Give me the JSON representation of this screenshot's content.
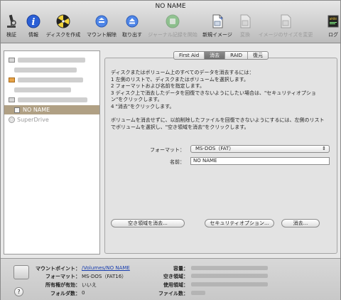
{
  "window": {
    "title": "NO NAME"
  },
  "toolbar": {
    "items": [
      {
        "label": "検証",
        "icon": "microscope-icon"
      },
      {
        "label": "情報",
        "icon": "info-icon"
      },
      {
        "label": "ディスクを作成",
        "icon": "burn-disc-icon"
      },
      {
        "label": "マウント解除",
        "icon": "unmount-icon"
      },
      {
        "label": "取り出す",
        "icon": "eject-icon"
      },
      {
        "label": "ジャーナル記録を開始",
        "icon": "journal-icon",
        "disabled": true
      },
      {
        "label": "新規イメージ",
        "icon": "new-image-icon"
      },
      {
        "label": "変換",
        "icon": "convert-icon",
        "disabled": true
      },
      {
        "label": "イメージのサイズを変更",
        "icon": "resize-image-icon",
        "disabled": true
      },
      {
        "label": "ログ",
        "icon": "log-icon"
      }
    ]
  },
  "sidebar": {
    "selected_volume": "NO NAME",
    "superdrive": "SuperDrive"
  },
  "tabs": [
    "First Aid",
    "消去",
    "RAID",
    "復元"
  ],
  "active_tab": "消去",
  "erase": {
    "instructions": [
      "ディスクまたはボリューム上のすべてのデータを消去するには：",
      "1  左側のリストで、ディスクまたはボリュームを選択します。",
      "2  フォーマットおよび名前を指定します。",
      "3  ディスク上で消去したデータを回復できないようにしたい場合は、\"セキュリティオプショ",
      "    ン\"をクリックします。",
      "4  \"消去\"をクリックします。",
      "",
      "ボリュームを消去せずに、以前削除したファイルを回復できないようにするには、左側のリスト",
      "でボリュームを選択し、\"空き領域を消去\"をクリックします。"
    ],
    "format_label": "フォーマット：",
    "format_value": "MS-DOS（FAT）",
    "name_label": "名前：",
    "name_value": "NO NAME",
    "erase_free_space_button": "空き領域を消去...",
    "security_options_button": "セキュリティオプション...",
    "erase_button": "消去..."
  },
  "info": {
    "mount_point_label": "マウントポイント：",
    "mount_point_value": "/Volumes/NO NAME",
    "format_label": "フォーマット：",
    "format_value": "MS-DOS（FAT16）",
    "ownership_label": "所有権が有効：",
    "ownership_value": "いいえ",
    "folders_label": "フォルダ数：",
    "folders_value": "0",
    "capacity_label": "容量：",
    "available_label": "空き領域：",
    "used_label": "使用領域：",
    "files_label": "ファイル数："
  }
}
